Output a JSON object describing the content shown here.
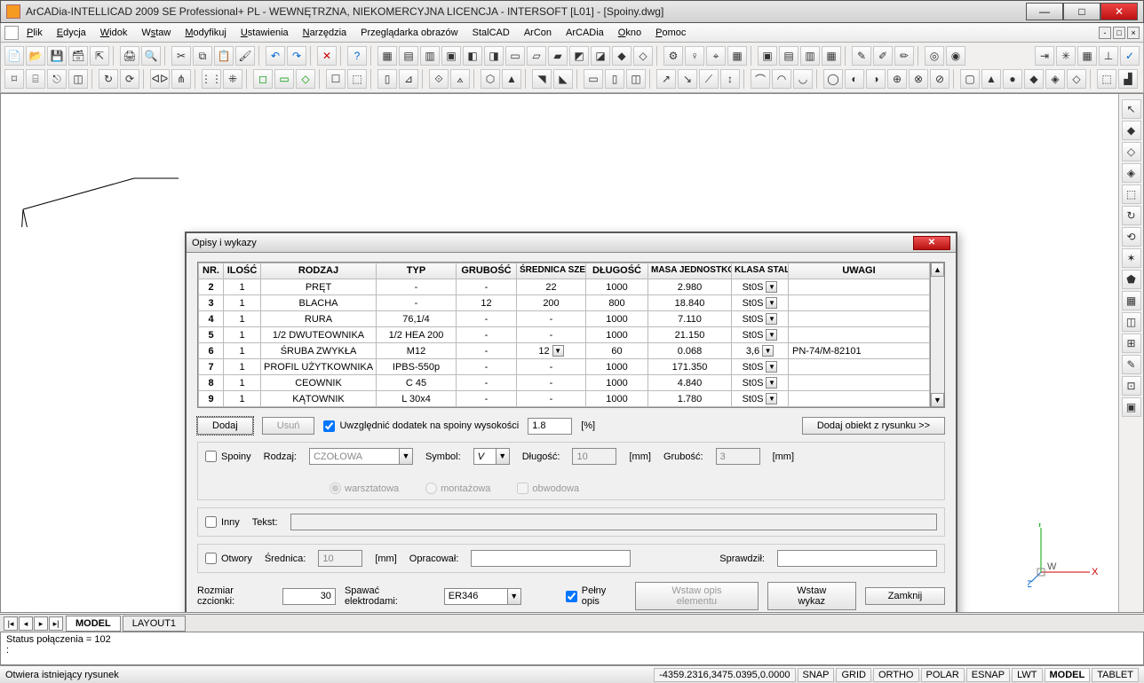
{
  "window": {
    "title": "ArCADia-INTELLICAD 2009 SE Professional+ PL - WEWNĘTRZNA, NIEKOMERCYJNA LICENCJA - INTERSOFT [L01] - [Spoiny.dwg]"
  },
  "menu": {
    "items": [
      "Plik",
      "Edycja",
      "Widok",
      "Wstaw",
      "Modyfikuj",
      "Ustawienia",
      "Narzędzia",
      "Przeglądarka obrazów",
      "StalCAD",
      "ArCon",
      "ArCADia",
      "Okno",
      "Pomoc"
    ]
  },
  "dialog": {
    "title": "Opisy i wykazy",
    "headers": {
      "nr": "NR.",
      "ilosc": "ILOŚĆ",
      "rodzaj": "RODZAJ",
      "typ": "TYP",
      "grubosc": "GRUBOŚĆ",
      "srednica": "ŚREDNICA SZEROKOŚĆ",
      "dlugosc": "DŁUGOŚĆ",
      "masa": "MASA JEDNOSTKOWA",
      "klasa": "KLASA STALI",
      "uwagi": "UWAGI"
    },
    "rows": [
      {
        "nr": "2",
        "ilosc": "1",
        "rodzaj": "PRĘT",
        "typ": "-",
        "grubosc": "-",
        "srednica": "22",
        "dlugosc": "1000",
        "masa": "2.980",
        "klasa": "St0S",
        "uwagi": ""
      },
      {
        "nr": "3",
        "ilosc": "1",
        "rodzaj": "BLACHA",
        "typ": "-",
        "grubosc": "12",
        "srednica": "200",
        "dlugosc": "800",
        "masa": "18.840",
        "klasa": "St0S",
        "uwagi": ""
      },
      {
        "nr": "4",
        "ilosc": "1",
        "rodzaj": "RURA",
        "typ": "76,1/4",
        "grubosc": "-",
        "srednica": "-",
        "dlugosc": "1000",
        "masa": "7.110",
        "klasa": "St0S",
        "uwagi": ""
      },
      {
        "nr": "5",
        "ilosc": "1",
        "rodzaj": "1/2 DWUTEOWNIKA",
        "typ": "1/2 HEA 200",
        "grubosc": "-",
        "srednica": "-",
        "dlugosc": "1000",
        "masa": "21.150",
        "klasa": "St0S",
        "uwagi": ""
      },
      {
        "nr": "6",
        "ilosc": "1",
        "rodzaj": "ŚRUBA ZWYKŁA",
        "typ": "M12",
        "grubosc": "-",
        "srednica": "12",
        "dlugosc": "60",
        "masa": "0.068",
        "klasa": "3,6",
        "uwagi": "PN-74/M-82101"
      },
      {
        "nr": "7",
        "ilosc": "1",
        "rodzaj": "PROFIL UŻYTKOWNIKA",
        "typ": "IPBS-550p",
        "grubosc": "-",
        "srednica": "-",
        "dlugosc": "1000",
        "masa": "171.350",
        "klasa": "St0S",
        "uwagi": ""
      },
      {
        "nr": "8",
        "ilosc": "1",
        "rodzaj": "CEOWNIK",
        "typ": "C 45",
        "grubosc": "-",
        "srednica": "-",
        "dlugosc": "1000",
        "masa": "4.840",
        "klasa": "St0S",
        "uwagi": ""
      },
      {
        "nr": "9",
        "ilosc": "1",
        "rodzaj": "KĄTOWNIK",
        "typ": "L 30x4",
        "grubosc": "-",
        "srednica": "-",
        "dlugosc": "1000",
        "masa": "1.780",
        "klasa": "St0S",
        "uwagi": ""
      }
    ],
    "buttons": {
      "dodaj": "Dodaj",
      "usun": "Usuń",
      "dodaj_obiekt": "Dodaj obiekt z rysunku >>",
      "wstaw_opis": "Wstaw opis elementu",
      "wstaw_wykaz": "Wstaw wykaz",
      "zamknij": "Zamknij"
    },
    "labels": {
      "uwzglednic": "Uwzględnić dodatek na spoiny wysokości",
      "pct": "[%]",
      "spoiny": "Spoiny",
      "rodzaj_l": "Rodzaj:",
      "symbol": "Symbol:",
      "dlugosc_l": "Długość:",
      "mm": "[mm]",
      "grubosc_l": "Grubość:",
      "warsztatowa": "warsztatowa",
      "montazowa": "montażowa",
      "obwodowa": "obwodowa",
      "inny": "Inny",
      "tekst": "Tekst:",
      "otwory": "Otwory",
      "srednica_l": "Średnica:",
      "opracowal": "Opracował:",
      "sprawdzil": "Sprawdził:",
      "rozmiar": "Rozmiar czcionki:",
      "spawac": "Spawać elektrodami:",
      "pelny": "Pełny opis"
    },
    "values": {
      "dodatek": "1.8",
      "rodzaj_sel": "CZOŁOWA",
      "symbol_sel": "V",
      "dlugosc_v": "10",
      "grubosc_v": "3",
      "srednica_v": "10",
      "rozmiar_v": "30",
      "elektrod": "ER346"
    }
  },
  "tabs": {
    "model": "MODEL",
    "layout1": "LAYOUT1"
  },
  "command": {
    "line1": "Status połączenia = 102",
    "prompt": ":"
  },
  "status": {
    "hint": "Otwiera istniejący rysunek",
    "coords": "-4359.2316,3475.0395,0.0000",
    "toggles": [
      "SNAP",
      "GRID",
      "ORTHO",
      "POLAR",
      "ESNAP",
      "LWT",
      "MODEL",
      "TABLET"
    ]
  },
  "ucs": {
    "x": "X",
    "y": "Y",
    "z": "Z",
    "w": "W"
  }
}
